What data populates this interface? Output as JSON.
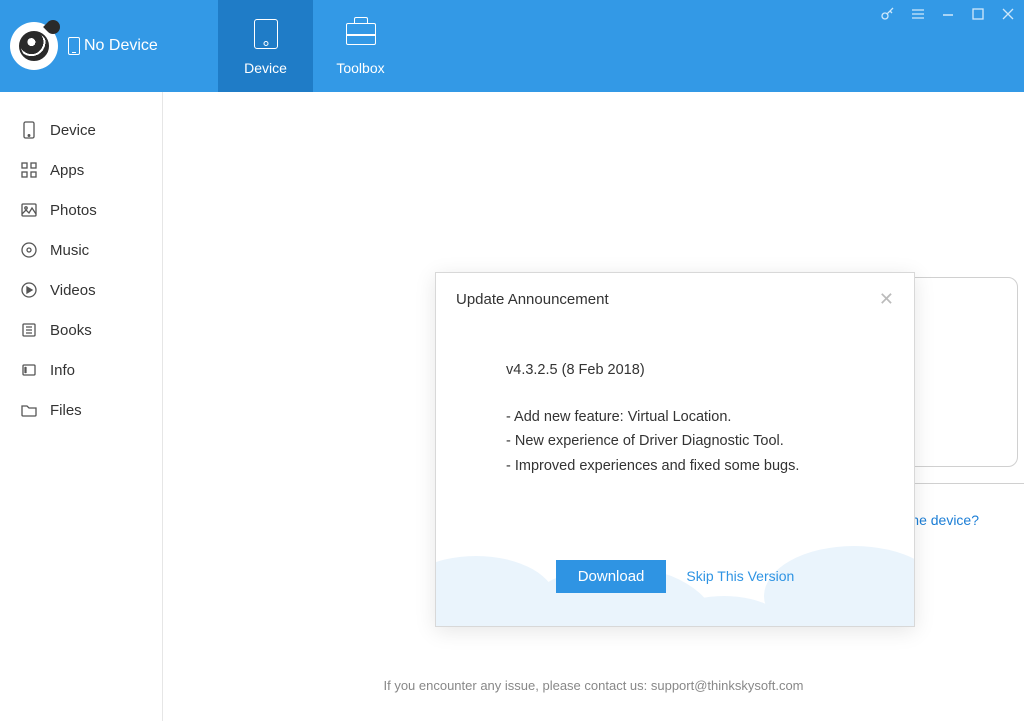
{
  "header": {
    "device_status": "No Device",
    "tabs": {
      "device": "Device",
      "toolbox": "Toolbox"
    }
  },
  "sidebar": {
    "items": [
      {
        "label": "Device",
        "icon": "device-icon"
      },
      {
        "label": "Apps",
        "icon": "apps-icon"
      },
      {
        "label": "Photos",
        "icon": "photos-icon"
      },
      {
        "label": "Music",
        "icon": "music-icon"
      },
      {
        "label": "Videos",
        "icon": "videos-icon"
      },
      {
        "label": "Books",
        "icon": "books-icon"
      },
      {
        "label": "Info",
        "icon": "info-icon"
      },
      {
        "label": "Files",
        "icon": "files-icon"
      }
    ]
  },
  "main": {
    "help_link": "Cannot recognize the device?",
    "footer": "If you encounter any issue, please contact us: support@thinkskysoft.com"
  },
  "modal": {
    "title": "Update Announcement",
    "version": "v4.3.2.5 (8 Feb 2018)",
    "changes": [
      "- Add new feature: Virtual Location.",
      "- New experience of Driver Diagnostic Tool.",
      "- Improved experiences and fixed some bugs."
    ],
    "download_label": "Download",
    "skip_label": "Skip This Version"
  }
}
